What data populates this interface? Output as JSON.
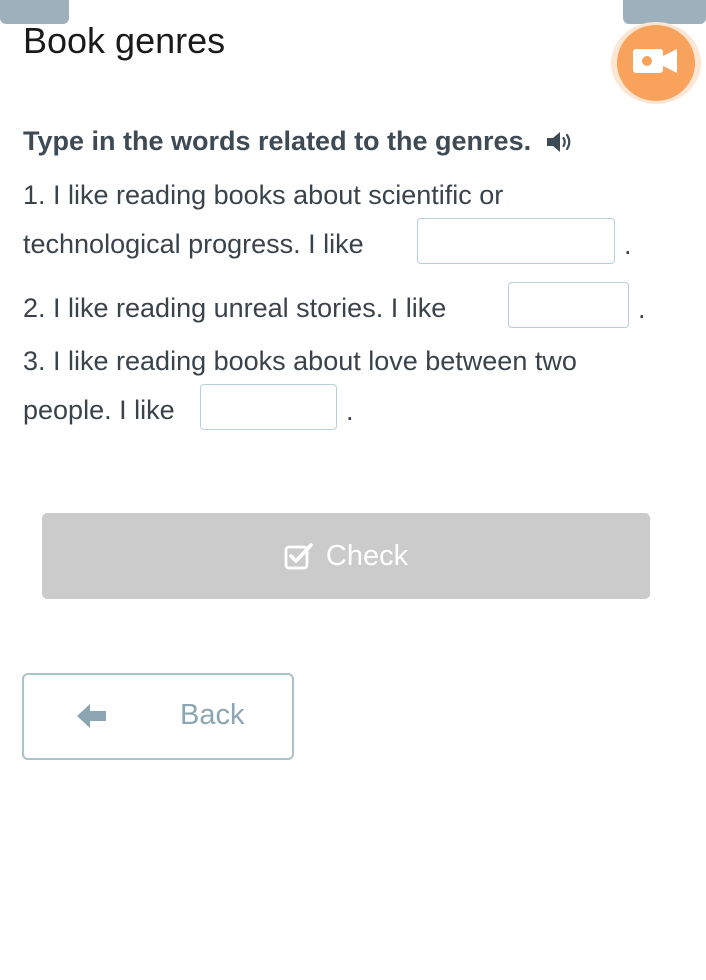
{
  "page": {
    "title": "Book genres",
    "instruction": "Type in the words related to the genres."
  },
  "tasks": [
    {
      "line1": "1. I like reading books about scientific or",
      "line2": "technological progress. I like",
      "answer": "",
      "end": "."
    },
    {
      "line1": "2. I like reading unreal stories. I like",
      "answer": "",
      "end": "."
    },
    {
      "line1": "3. I like reading books about love between two",
      "line2": "people. I like",
      "answer": "",
      "end": "."
    }
  ],
  "buttons": {
    "check_label": "Check",
    "back_label": "Back"
  },
  "icons": {
    "video": "video-camera-icon",
    "speaker": "speaker-icon",
    "check": "checkbox-check-icon",
    "back": "arrow-left-icon"
  },
  "colors": {
    "video_button": "#f9a25b",
    "check_button_disabled": "#cbcbcb",
    "back_border": "#a9c3cb",
    "input_border": "#b5d0d6"
  }
}
